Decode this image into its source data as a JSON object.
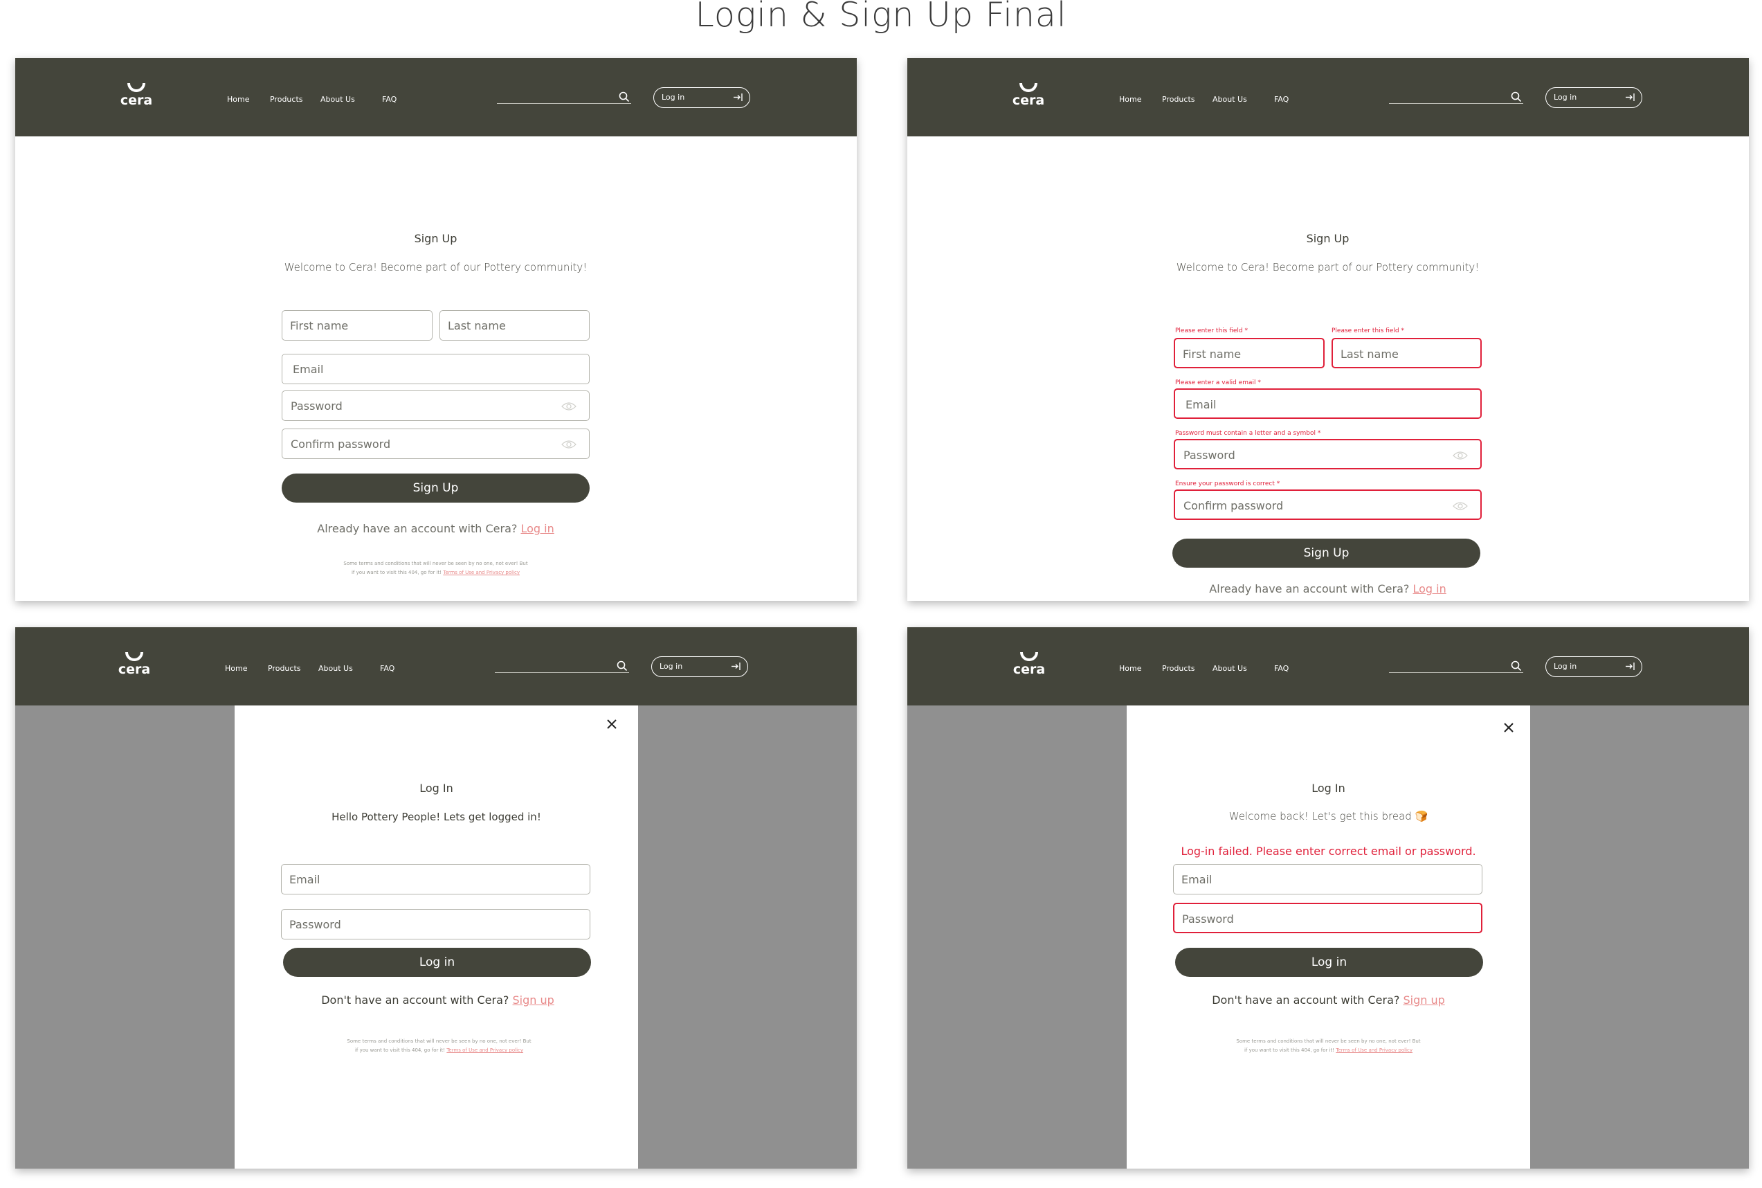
{
  "board_title": "Login & Sign Up Final",
  "nav": {
    "logo_text": "cera",
    "links": [
      "Home",
      "Products",
      "About Us",
      "FAQ"
    ],
    "login_button": "Log in"
  },
  "signup": {
    "title": "Sign Up",
    "subtitle": "Welcome to Cera! Become part of our Pottery community!",
    "first_name_placeholder": "First name",
    "last_name_placeholder": "Last name",
    "email_placeholder": "Email",
    "password_placeholder": "Password",
    "confirm_password_placeholder": "Confirm password",
    "button": "Sign Up",
    "have_account_text": "Already have an account with Cera?",
    "login_link": "Log in",
    "errors": {
      "first_name": "Please enter this field *",
      "last_name": "Please enter this field *",
      "email": "Please enter a valid email *",
      "password": "Password must contain a letter and a symbol *",
      "confirm_password": "Ensure your password is correct *"
    }
  },
  "legal": {
    "line1": "Some terms and conditions that will never be seen by no one, not ever! But",
    "line2_prefix": "if you want to visit this 404, go for it!",
    "link": "Terms of Use and Privacy policy"
  },
  "login": {
    "title": "Log In",
    "greeting_default": "Hello Pottery People! Lets get logged in!",
    "greeting_error": "Welcome back! Let's get this bread 🍞",
    "error_message": "Log-in failed. Please enter correct email or password.",
    "email_placeholder": "Email",
    "password_placeholder": "Password",
    "button": "Log in",
    "no_account_text": "Don't have an account with Cera?",
    "signup_link": "Sign up"
  },
  "colors": {
    "nav_bg": "#44453b",
    "error": "#e0203a",
    "link": "#e88a8a",
    "overlay": "#909090"
  }
}
